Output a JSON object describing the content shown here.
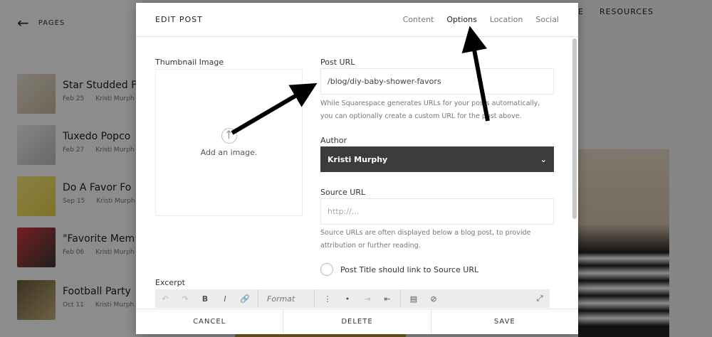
{
  "background": {
    "pages_label": "PAGES",
    "nav_items": [
      "E",
      "RESOURCES"
    ],
    "posts": [
      {
        "title": "Star Studded F",
        "date": "Feb 25",
        "author": "Kristi Murph"
      },
      {
        "title": "Tuxedo Popco",
        "date": "Feb 27",
        "author": "Kristi Murph"
      },
      {
        "title": "Do A Favor Fo",
        "date": "Sep 15",
        "author": "Kristi Murph"
      },
      {
        "title": "\"Favorite Mem",
        "date": "Feb 06",
        "author": "Kristi Murph"
      },
      {
        "title": "Football Party",
        "date": "Oct 11",
        "author": "Kristi Murph"
      }
    ]
  },
  "modal": {
    "title": "EDIT POST",
    "tabs": [
      "Content",
      "Options",
      "Location",
      "Social"
    ],
    "active_tab": "Options",
    "thumbnail": {
      "label": "Thumbnail Image",
      "add_text": "Add an image."
    },
    "post_url": {
      "label": "Post URL",
      "value": "/blog/diy-baby-shower-favors",
      "help_line1": "While Squarespace generates URLs for your posts automatically,",
      "help_line2": "you can optionally create a custom URL for the post above."
    },
    "author": {
      "label": "Author",
      "value": "Kristi Murphy"
    },
    "source_url": {
      "label": "Source URL",
      "placeholder": "http://...",
      "help_line1": "Source URLs are often displayed below a blog post, to provide",
      "help_line2": "attribution or further reading."
    },
    "link_option": "Post Title should link to Source URL",
    "excerpt": {
      "label": "Excerpt",
      "format_label": "Format"
    },
    "footer": {
      "cancel": "CANCEL",
      "delete": "DELETE",
      "save": "SAVE"
    }
  },
  "colors": {
    "author_select_bg": "#3c3c3c",
    "annotation_arrow": "#000000"
  }
}
